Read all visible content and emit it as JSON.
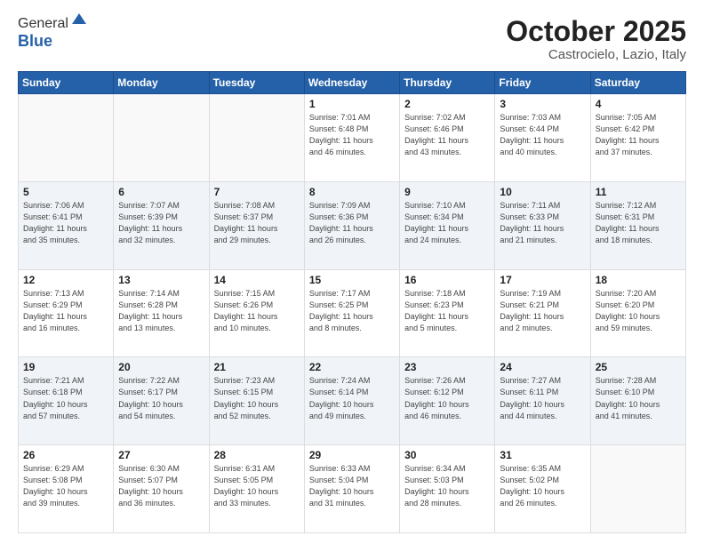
{
  "header": {
    "logo_line1": "General",
    "logo_line2": "Blue",
    "month": "October 2025",
    "location": "Castrocielo, Lazio, Italy"
  },
  "weekdays": [
    "Sunday",
    "Monday",
    "Tuesday",
    "Wednesday",
    "Thursday",
    "Friday",
    "Saturday"
  ],
  "rows": [
    [
      {
        "day": "",
        "info": ""
      },
      {
        "day": "",
        "info": ""
      },
      {
        "day": "",
        "info": ""
      },
      {
        "day": "1",
        "info": "Sunrise: 7:01 AM\nSunset: 6:48 PM\nDaylight: 11 hours\nand 46 minutes."
      },
      {
        "day": "2",
        "info": "Sunrise: 7:02 AM\nSunset: 6:46 PM\nDaylight: 11 hours\nand 43 minutes."
      },
      {
        "day": "3",
        "info": "Sunrise: 7:03 AM\nSunset: 6:44 PM\nDaylight: 11 hours\nand 40 minutes."
      },
      {
        "day": "4",
        "info": "Sunrise: 7:05 AM\nSunset: 6:42 PM\nDaylight: 11 hours\nand 37 minutes."
      }
    ],
    [
      {
        "day": "5",
        "info": "Sunrise: 7:06 AM\nSunset: 6:41 PM\nDaylight: 11 hours\nand 35 minutes."
      },
      {
        "day": "6",
        "info": "Sunrise: 7:07 AM\nSunset: 6:39 PM\nDaylight: 11 hours\nand 32 minutes."
      },
      {
        "day": "7",
        "info": "Sunrise: 7:08 AM\nSunset: 6:37 PM\nDaylight: 11 hours\nand 29 minutes."
      },
      {
        "day": "8",
        "info": "Sunrise: 7:09 AM\nSunset: 6:36 PM\nDaylight: 11 hours\nand 26 minutes."
      },
      {
        "day": "9",
        "info": "Sunrise: 7:10 AM\nSunset: 6:34 PM\nDaylight: 11 hours\nand 24 minutes."
      },
      {
        "day": "10",
        "info": "Sunrise: 7:11 AM\nSunset: 6:33 PM\nDaylight: 11 hours\nand 21 minutes."
      },
      {
        "day": "11",
        "info": "Sunrise: 7:12 AM\nSunset: 6:31 PM\nDaylight: 11 hours\nand 18 minutes."
      }
    ],
    [
      {
        "day": "12",
        "info": "Sunrise: 7:13 AM\nSunset: 6:29 PM\nDaylight: 11 hours\nand 16 minutes."
      },
      {
        "day": "13",
        "info": "Sunrise: 7:14 AM\nSunset: 6:28 PM\nDaylight: 11 hours\nand 13 minutes."
      },
      {
        "day": "14",
        "info": "Sunrise: 7:15 AM\nSunset: 6:26 PM\nDaylight: 11 hours\nand 10 minutes."
      },
      {
        "day": "15",
        "info": "Sunrise: 7:17 AM\nSunset: 6:25 PM\nDaylight: 11 hours\nand 8 minutes."
      },
      {
        "day": "16",
        "info": "Sunrise: 7:18 AM\nSunset: 6:23 PM\nDaylight: 11 hours\nand 5 minutes."
      },
      {
        "day": "17",
        "info": "Sunrise: 7:19 AM\nSunset: 6:21 PM\nDaylight: 11 hours\nand 2 minutes."
      },
      {
        "day": "18",
        "info": "Sunrise: 7:20 AM\nSunset: 6:20 PM\nDaylight: 10 hours\nand 59 minutes."
      }
    ],
    [
      {
        "day": "19",
        "info": "Sunrise: 7:21 AM\nSunset: 6:18 PM\nDaylight: 10 hours\nand 57 minutes."
      },
      {
        "day": "20",
        "info": "Sunrise: 7:22 AM\nSunset: 6:17 PM\nDaylight: 10 hours\nand 54 minutes."
      },
      {
        "day": "21",
        "info": "Sunrise: 7:23 AM\nSunset: 6:15 PM\nDaylight: 10 hours\nand 52 minutes."
      },
      {
        "day": "22",
        "info": "Sunrise: 7:24 AM\nSunset: 6:14 PM\nDaylight: 10 hours\nand 49 minutes."
      },
      {
        "day": "23",
        "info": "Sunrise: 7:26 AM\nSunset: 6:12 PM\nDaylight: 10 hours\nand 46 minutes."
      },
      {
        "day": "24",
        "info": "Sunrise: 7:27 AM\nSunset: 6:11 PM\nDaylight: 10 hours\nand 44 minutes."
      },
      {
        "day": "25",
        "info": "Sunrise: 7:28 AM\nSunset: 6:10 PM\nDaylight: 10 hours\nand 41 minutes."
      }
    ],
    [
      {
        "day": "26",
        "info": "Sunrise: 6:29 AM\nSunset: 5:08 PM\nDaylight: 10 hours\nand 39 minutes."
      },
      {
        "day": "27",
        "info": "Sunrise: 6:30 AM\nSunset: 5:07 PM\nDaylight: 10 hours\nand 36 minutes."
      },
      {
        "day": "28",
        "info": "Sunrise: 6:31 AM\nSunset: 5:05 PM\nDaylight: 10 hours\nand 33 minutes."
      },
      {
        "day": "29",
        "info": "Sunrise: 6:33 AM\nSunset: 5:04 PM\nDaylight: 10 hours\nand 31 minutes."
      },
      {
        "day": "30",
        "info": "Sunrise: 6:34 AM\nSunset: 5:03 PM\nDaylight: 10 hours\nand 28 minutes."
      },
      {
        "day": "31",
        "info": "Sunrise: 6:35 AM\nSunset: 5:02 PM\nDaylight: 10 hours\nand 26 minutes."
      },
      {
        "day": "",
        "info": ""
      }
    ]
  ]
}
